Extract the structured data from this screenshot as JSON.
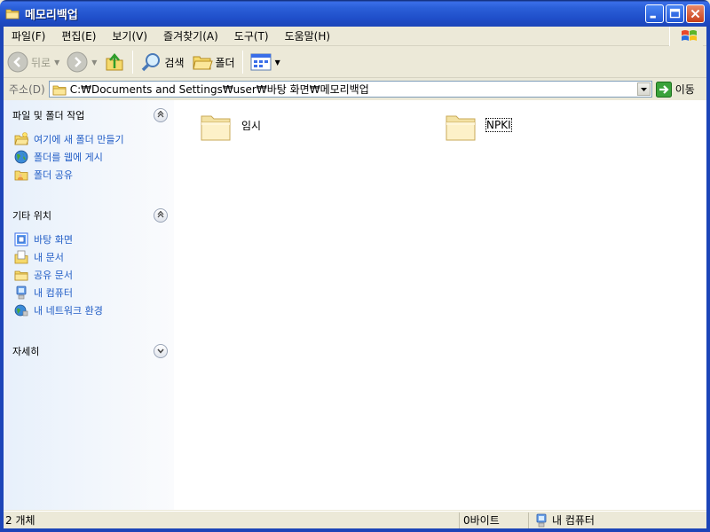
{
  "window": {
    "title": "메모리백업"
  },
  "menu": {
    "items": [
      "파일(F)",
      "편집(E)",
      "보기(V)",
      "즐겨찾기(A)",
      "도구(T)",
      "도움말(H)"
    ]
  },
  "toolbar": {
    "back_label": "뒤로",
    "search_label": "검색",
    "folders_label": "폴더"
  },
  "address": {
    "label": "주소(D)",
    "path": "C:₩Documents and Settings₩user₩바탕 화면₩메모리백업",
    "go_label": "이동"
  },
  "left_pane": {
    "file_tasks": {
      "title": "파일 및 폴더 작업",
      "items": [
        {
          "label": "여기에 새 폴더 만들기",
          "icon": "new-folder-icon"
        },
        {
          "label": "폴더를 웹에 게시",
          "icon": "publish-web-icon"
        },
        {
          "label": "폴더 공유",
          "icon": "share-folder-icon"
        }
      ]
    },
    "other_places": {
      "title": "기타 위치",
      "items": [
        {
          "label": "바탕 화면",
          "icon": "desktop-icon"
        },
        {
          "label": "내 문서",
          "icon": "my-documents-icon"
        },
        {
          "label": "공유 문서",
          "icon": "shared-documents-icon"
        },
        {
          "label": "내 컴퓨터",
          "icon": "my-computer-icon"
        },
        {
          "label": "내 네트워크 환경",
          "icon": "my-network-icon"
        }
      ]
    },
    "details": {
      "title": "자세히"
    }
  },
  "files": [
    {
      "name": "임시",
      "icon": "folder-icon"
    },
    {
      "name": "NPKI",
      "icon": "folder-icon"
    }
  ],
  "status": {
    "count": "2 개체",
    "size": "0바이트",
    "location": "내 컴퓨터"
  },
  "colors": {
    "titlebar": "#245edb",
    "link_blue": "#215dc6",
    "panel_bg": "#e7f0fb"
  }
}
